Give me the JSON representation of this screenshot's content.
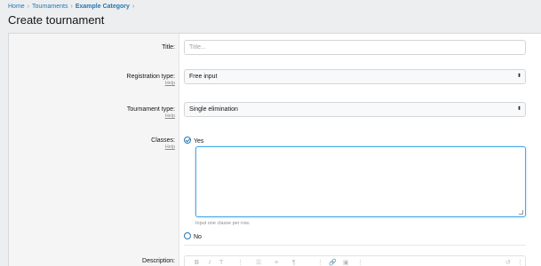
{
  "breadcrumb": {
    "items": [
      "Home",
      "Tournaments",
      "Example Category"
    ],
    "separator": "›"
  },
  "page": {
    "title": "Create tournament"
  },
  "form": {
    "title": {
      "label": "Title:",
      "placeholder": "Title..."
    },
    "registration_type": {
      "label": "Registration type:",
      "help": "Help",
      "value": "Free input"
    },
    "tournament_type": {
      "label": "Tournament type:",
      "help": "Help",
      "value": "Single elimination"
    },
    "classes": {
      "label": "Classes:",
      "help": "Help",
      "yes_label": "Yes",
      "yes_selected": true,
      "hint": "Input one classe per row.",
      "no_label": "No"
    },
    "description": {
      "label": "Description:"
    }
  },
  "editor_toolbar": {
    "bold": "B",
    "italic": "I",
    "text_size": "T",
    "more": "⋮",
    "list": "☰",
    "align": "≡",
    "paragraph": "¶",
    "link": "🔗",
    "image": "▣",
    "undo": "↺"
  },
  "colors": {
    "link": "#2577b1",
    "focus": "#47a7eb",
    "help": "#8c8c8c"
  }
}
